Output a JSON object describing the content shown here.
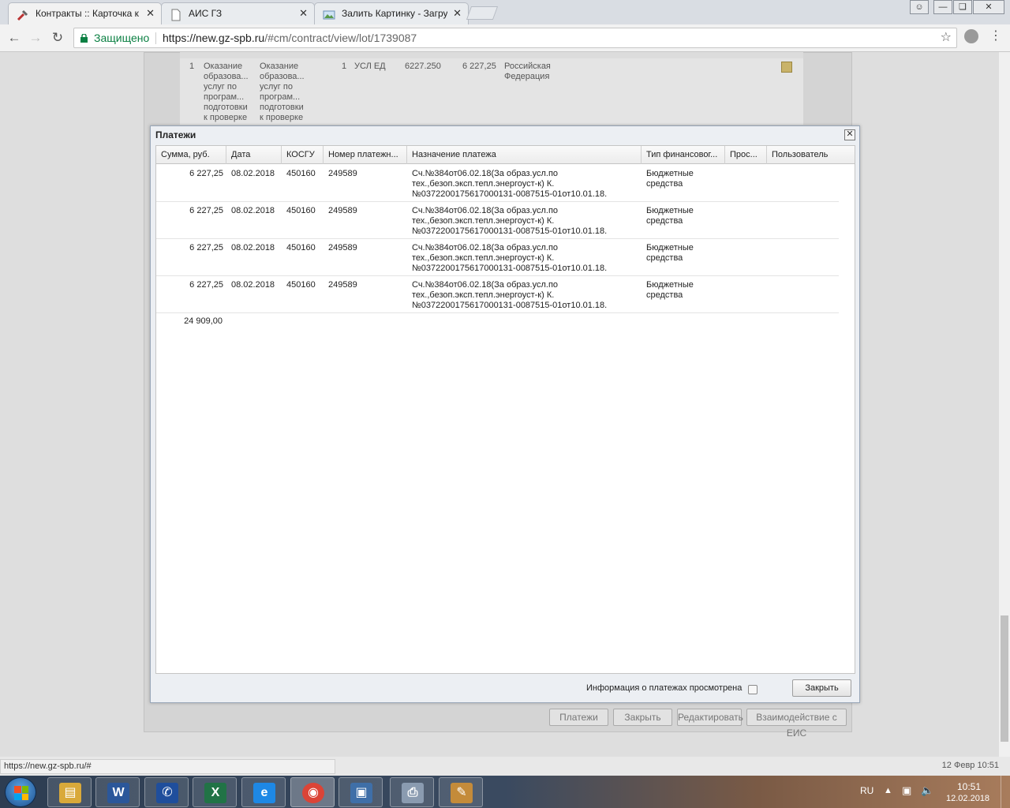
{
  "browser": {
    "tabs": [
      {
        "label": "Контракты :: Карточка к",
        "icon": "tools-icon",
        "active": true
      },
      {
        "label": "АИС ГЗ",
        "icon": "document-icon",
        "active": false
      },
      {
        "label": "Залить Картинку - Загру",
        "icon": "image-icon",
        "active": false
      }
    ],
    "secure_label": "Защищено",
    "url_host": "https://new.gz-spb.ru",
    "url_path": "/#cm/contract/view/lot/1739087"
  },
  "background": {
    "row": {
      "num": "1",
      "name1": "Оказание\nобразова...\nуслуг по\nпрограм...\nподготовки\nк проверке",
      "name2": "Оказание\nобразова...\nуслуг по\nпрограм...\nподготовки\nк проверке",
      "qty": "1",
      "unit": "УСЛ ЕД",
      "price": "6227.250",
      "sum": "6 227,25",
      "country": "Российская\nФедерация"
    },
    "buttons": [
      "Платежи",
      "Закрыть",
      "Редактировать",
      "Взаимодействие с ЕИС"
    ]
  },
  "dialog": {
    "title": "Платежи",
    "columns": [
      "Сумма, руб.",
      "Дата",
      "КОСГУ",
      "Номер платежн...",
      "Назначение платежа",
      "Тип финансовог...",
      "Прос...",
      "Пользователь"
    ],
    "rows": [
      {
        "sum": "6 227,25",
        "date": "08.02.2018",
        "kosgu": "450160",
        "number": "249589",
        "purpose": "Сч.№384от06.02.18(За образ.усл.по\nтех.,безоп.эксп.тепл.энергоуст-к) К.\n№0372200175617000131-0087515-01от10.01.18.",
        "fin_type": "Бюджетные\nсредства",
        "overdue": "",
        "user": ""
      },
      {
        "sum": "6 227,25",
        "date": "08.02.2018",
        "kosgu": "450160",
        "number": "249589",
        "purpose": "Сч.№384от06.02.18(За образ.усл.по\nтех.,безоп.эксп.тепл.энергоуст-к) К.\n№0372200175617000131-0087515-01от10.01.18.",
        "fin_type": "Бюджетные\nсредства",
        "overdue": "",
        "user": ""
      },
      {
        "sum": "6 227,25",
        "date": "08.02.2018",
        "kosgu": "450160",
        "number": "249589",
        "purpose": "Сч.№384от06.02.18(За образ.усл.по\nтех.,безоп.эксп.тепл.энергоуст-к) К.\n№0372200175617000131-0087515-01от10.01.18.",
        "fin_type": "Бюджетные\nсредства",
        "overdue": "",
        "user": ""
      },
      {
        "sum": "6 227,25",
        "date": "08.02.2018",
        "kosgu": "450160",
        "number": "249589",
        "purpose": "Сч.№384от06.02.18(За образ.усл.по\nтех.,безоп.эксп.тепл.энергоуст-к) К.\n№0372200175617000131-0087515-01от10.01.18.",
        "fin_type": "Бюджетные\nсредства",
        "overdue": "",
        "user": ""
      }
    ],
    "total": "24 909,00",
    "viewed_label": "Информация о платежах просмотрена",
    "viewed_checked": false,
    "close_label": "Закрыть"
  },
  "status": {
    "hover_url": "https://new.gz-spb.ru/#",
    "date_text": "12 Февр 10:51"
  },
  "taskbar": {
    "apps": [
      {
        "name": "file-explorer-icon",
        "color": "#d9a93a",
        "glyph": "▤"
      },
      {
        "name": "word-icon",
        "color": "#2b579a",
        "glyph": "W"
      },
      {
        "name": "phone-icon",
        "color": "#1f4e9c",
        "glyph": "✆"
      },
      {
        "name": "excel-icon",
        "color": "#217346",
        "glyph": "X"
      },
      {
        "name": "internet-explorer-icon",
        "color": "#1e88e5",
        "glyph": "e"
      },
      {
        "name": "chrome-icon",
        "color": "#db4437",
        "glyph": "◉"
      },
      {
        "name": "image-viewer-icon",
        "color": "#3f6fa8",
        "glyph": "▣"
      },
      {
        "name": "scanner-icon",
        "color": "#8a9bb0",
        "glyph": "⎙"
      },
      {
        "name": "paint-icon",
        "color": "#c48b3a",
        "glyph": "✎"
      }
    ],
    "lang": "RU",
    "time": "10:51",
    "date": "12.02.2018"
  }
}
